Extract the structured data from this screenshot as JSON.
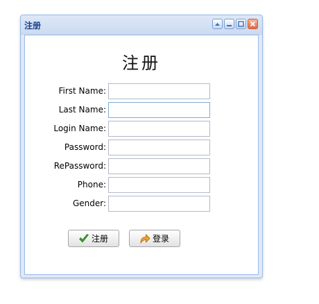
{
  "window": {
    "title": "注册",
    "tools": [
      "collapse-icon",
      "minimize-icon",
      "maximize-icon",
      "close-icon"
    ]
  },
  "form": {
    "heading": "注册",
    "fields": [
      {
        "label": "First Name:",
        "value": ""
      },
      {
        "label": "Last Name:",
        "value": ""
      },
      {
        "label": "Login Name:",
        "value": ""
      },
      {
        "label": "Password:",
        "value": ""
      },
      {
        "label": "RePassword:",
        "value": ""
      },
      {
        "label": "Phone:",
        "value": ""
      },
      {
        "label": "Gender:",
        "value": ""
      }
    ]
  },
  "buttons": {
    "register_label": "注册",
    "register_icon": "checkmark-icon",
    "login_label": "登录",
    "login_icon": "forward-arrow-icon"
  },
  "colors": {
    "title_text": "#15428b",
    "border": "#99bbe8",
    "check": "#3a9a2a",
    "arrow": "#f0a030"
  }
}
